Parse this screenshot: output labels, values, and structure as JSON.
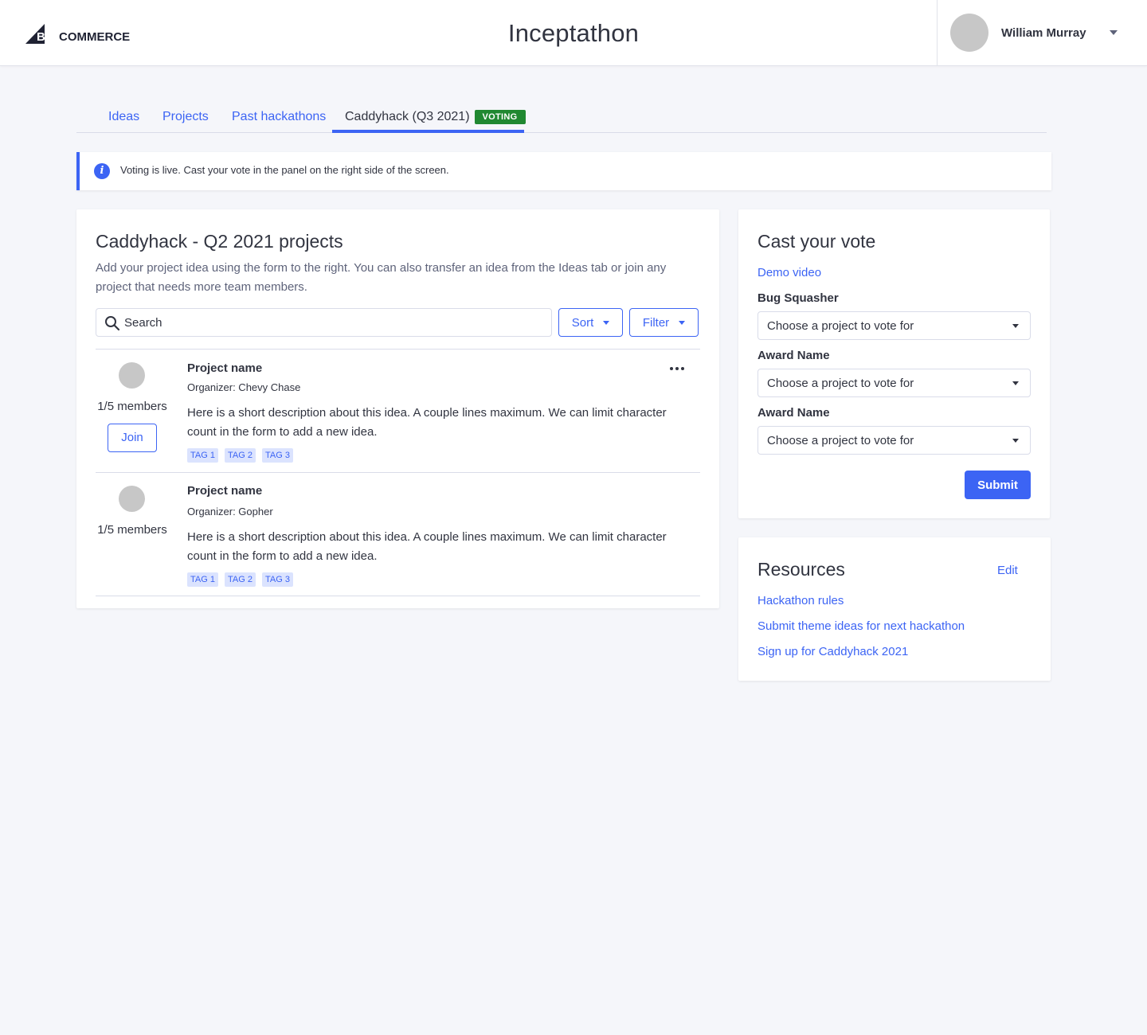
{
  "header": {
    "logo_text": "BIGCOMMERCE",
    "app_title": "Inceptathon",
    "user_name": "William Murray"
  },
  "tabs": [
    {
      "label": "Ideas"
    },
    {
      "label": "Projects"
    },
    {
      "label": "Past hackathons"
    },
    {
      "label": "Caddyhack (Q3 2021)",
      "badge": "VOTING",
      "active": true
    }
  ],
  "alert": {
    "text": "Voting is live. Cast your vote in the panel on the right side of the screen."
  },
  "projects_panel": {
    "title": "Caddyhack - Q2 2021 projects",
    "description": "Add your project idea using the form to the right. You can also transfer an idea from the Ideas tab or join any project that needs more team members.",
    "search_placeholder": "Search",
    "sort_label": "Sort",
    "filter_label": "Filter",
    "projects": [
      {
        "members": "1/5 members",
        "join_label": "Join",
        "name": "Project name",
        "organizer": "Organizer: Chevy Chase",
        "description": "Here is a short description about this idea. A couple lines maximum. We can limit character count in the form to add a new idea.",
        "tags": [
          "TAG 1",
          "TAG 2",
          "TAG 3"
        ]
      },
      {
        "members": "1/5 members",
        "name": "Project name",
        "organizer": "Organizer: Gopher",
        "description": "Here is a short description about this idea. A couple lines maximum. We can limit character count in the form to add a new idea.",
        "tags": [
          "TAG 1",
          "TAG 2",
          "TAG 3"
        ]
      }
    ]
  },
  "vote_panel": {
    "title": "Cast your vote",
    "demo_link": "Demo video",
    "awards": [
      {
        "label": "Bug Squasher",
        "placeholder": "Choose a project to vote for"
      },
      {
        "label": "Award Name",
        "placeholder": "Choose a project to vote for"
      },
      {
        "label": "Award Name",
        "placeholder": "Choose a project to vote for"
      }
    ],
    "submit_label": "Submit"
  },
  "resources_panel": {
    "title": "Resources",
    "edit_label": "Edit",
    "links": [
      "Hackathon rules",
      "Submit theme ideas for next hackathon",
      "Sign up for Caddyhack 2021"
    ]
  },
  "colors": {
    "accent": "#3c64f4",
    "voting_badge": "#208831",
    "background": "#f5f6fa",
    "avatar_placeholder": "#c7c7c7"
  },
  "icons": {
    "alert": "info-icon",
    "search": "search-icon",
    "more": "more-horizontal-icon",
    "user_menu": "caret-down-icon"
  }
}
